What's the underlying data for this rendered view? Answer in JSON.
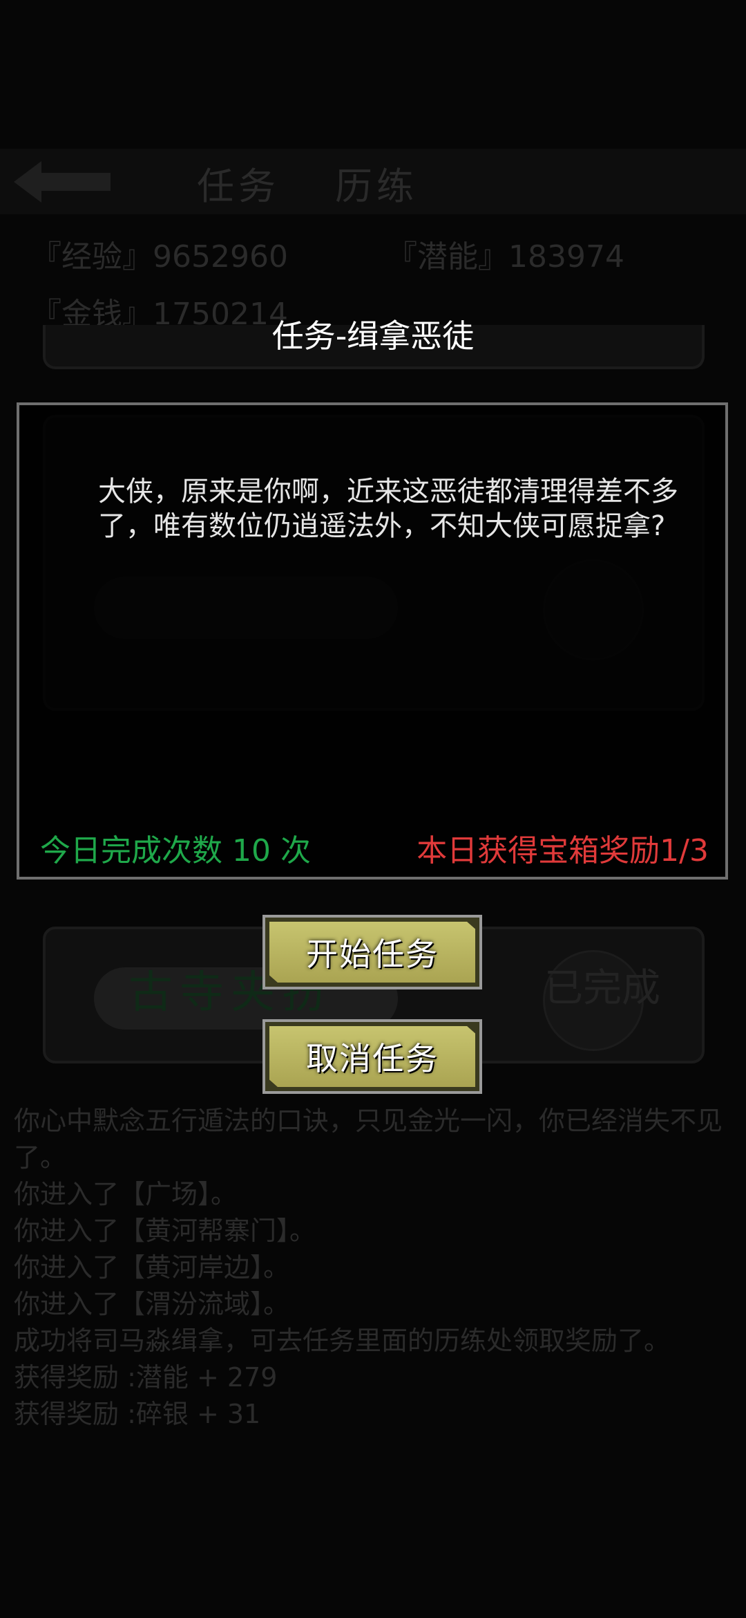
{
  "background": {
    "tabs": [
      "任务",
      "历练"
    ],
    "stats": {
      "exp": "『经验』9652960",
      "potential": "『潜能』183974",
      "money": "『金钱』1750214"
    },
    "quest_card": {
      "title": "古寺夹扮",
      "status": "已完成"
    },
    "log": [
      "你心中默念五行遁法的口诀，只见金光一闪，你已经消失不见了。",
      "你进入了【广场】。",
      "你进入了【黄河帮寨门】。",
      "你进入了【黄河岸边】。",
      "你进入了【渭汾流域】。",
      "成功将司马淼缉拿，可去任务里面的历练处领取奖励了。",
      "获得奖励 :潜能 + 279",
      "获得奖励 :碎银 + 31"
    ]
  },
  "modal": {
    "title": "任务-缉拿恶徒",
    "message": "大侠，原来是你啊，近来这恶徒都清理得差不多了，唯有数位仍逍遥法外，不知大侠可愿捉拿?",
    "daily_count": "今日完成次数 10 次",
    "chest_reward": "本日获得宝箱奖励1/3",
    "colors": {
      "count": "#1fa84a",
      "reward": "#e03a3a",
      "button": "#c7c46f"
    }
  },
  "buttons": {
    "start": "开始任务",
    "cancel": "取消任务"
  }
}
